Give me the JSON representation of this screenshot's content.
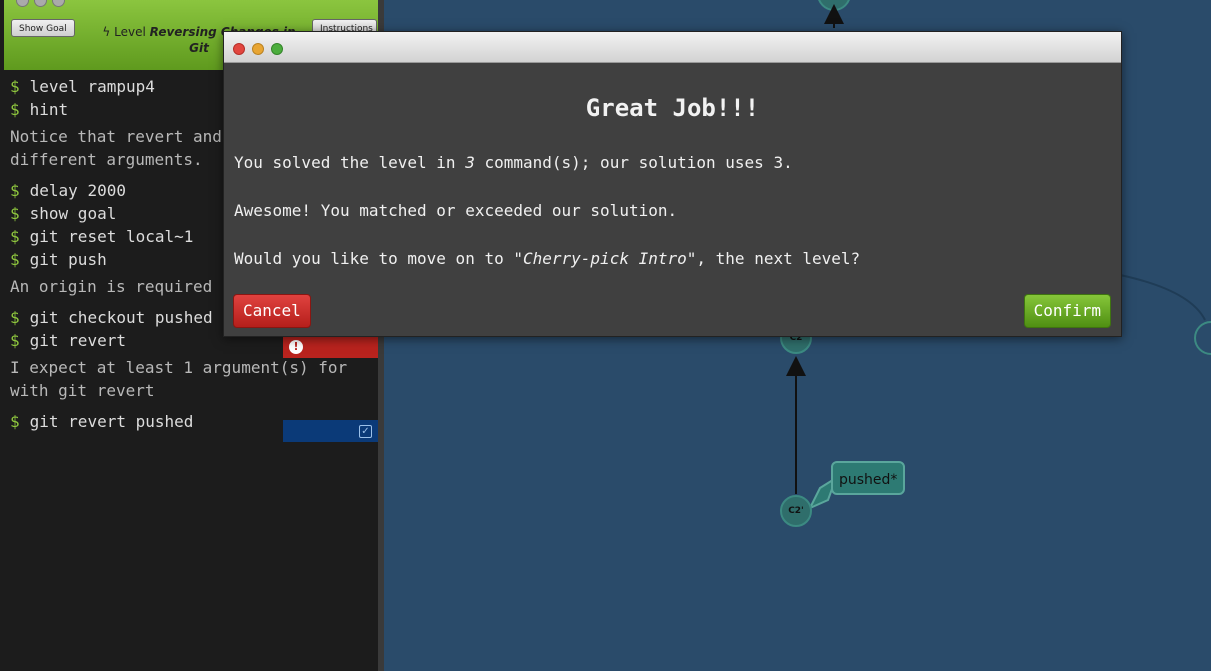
{
  "terminal": {
    "show_goal_label": "Show Goal",
    "instructions_label": "Instructions",
    "level_prefix": "Level",
    "level_name": "Reversing Changes in Git",
    "prompt_symbol": "$",
    "lines": [
      {
        "cmd": "level rampup4"
      },
      {
        "cmd": "hint"
      },
      {
        "msg": "Notice that revert and\ndifferent arguments."
      },
      {
        "cmd": "delay 2000"
      },
      {
        "cmd": "show goal"
      },
      {
        "cmd": "git reset local~1"
      },
      {
        "cmd": "git push"
      },
      {
        "msg": "An origin is required"
      },
      {
        "cmd": "git checkout pushed"
      },
      {
        "cmd": "git revert"
      },
      {
        "msg": "I expect at least 1 argument(s) for\nwith git revert"
      },
      {
        "cmd": "git revert pushed"
      }
    ],
    "error_icon": "!",
    "ok_icon": "✓"
  },
  "graph": {
    "commits": [
      {
        "id": "C2",
        "label": "C2"
      },
      {
        "id": "C2prime",
        "label": "C2'"
      }
    ],
    "branch": "pushed*"
  },
  "modal": {
    "title": "Great Job!!!",
    "line1_a": "You solved the level in ",
    "line1_num": "3",
    "line1_b": " command(s); our solution uses 3.",
    "line2": "Awesome! You matched or exceeded our solution.",
    "line3_a": "Would you like to move on to ",
    "line3_level": "\"Cherry-pick Intro\"",
    "line3_b": ", the next level?",
    "cancel_label": "Cancel",
    "confirm_label": "Confirm",
    "colors": {
      "close": "#e2463f",
      "minimize": "#e8a533",
      "zoom": "#4cad3d",
      "confirm": "#6aab25",
      "cancel": "#cc2f2a"
    }
  }
}
